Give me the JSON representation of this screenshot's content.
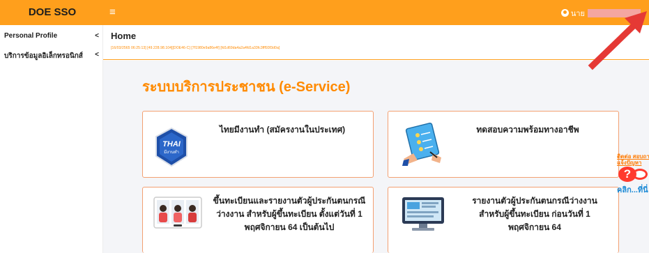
{
  "topbar": {
    "brand": "DOE SSO",
    "user_prefix": "นาย"
  },
  "sidebar": {
    "items": [
      {
        "label": "Personal Profile",
        "chevron": "<"
      },
      {
        "label": "บริการข้อมูลอิเล็กทรอนิกส์",
        "chevron": "<"
      }
    ]
  },
  "header": {
    "title": "Home",
    "session_info": "[16/03/2565 06:25:13] [49.228.98.104][DOE46-C] [7f1980e9a86e4f] [fd1d69da4a2a4fd1a33fc3fff93f3d0a]"
  },
  "main": {
    "service_title": "ระบบบริการประชาชน (e-Service)",
    "cards": [
      {
        "lines": [
          "ไทยมีงานทำ (สมัครงานในประเทศ)"
        ]
      },
      {
        "lines": [
          "ทดสอบความพร้อมทางอาชีพ"
        ]
      },
      {
        "lines": [
          "ขึ้นทะเบียนและรายงานตัวผู้ประกันตนกรณี",
          "ว่างงาน สำหรับผู้ขึ้นทะเบียน ตั้งแต่วันที่ 1",
          "พฤศจิกายน 64 เป็นต้นไป"
        ]
      },
      {
        "lines": [
          "รายงานตัวผู้ประกันตนกรณีว่างงาน",
          "สำหรับผู้ขึ้นทะเบียน ก่อนวันที่ 1",
          "พฤศจิกายน 64"
        ]
      }
    ],
    "thai_logo": {
      "line1": "THAI",
      "line2": "มีงานทำ"
    }
  },
  "helper": {
    "line1": "ติดต่อ สอบถาม",
    "line2": "แจ้งปัญหา",
    "click": "คลิก...ที่นี่"
  },
  "colors": {
    "accent": "#ff9f1c",
    "title_orange": "#ff8a00",
    "card_border": "#f3a072",
    "arrow_red": "#e53935"
  }
}
